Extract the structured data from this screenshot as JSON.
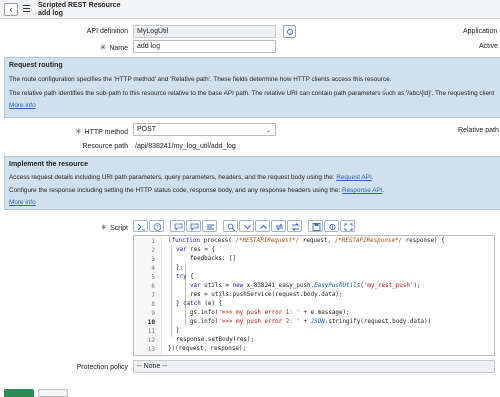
{
  "header": {
    "title": "Scripted REST Resource",
    "subtitle": "add log",
    "back_icon": "chevron-left-icon",
    "menu_icon": "hamburger-menu-icon"
  },
  "form": {
    "api_definition_label": "API definition",
    "api_definition_value": "MyLogUtil",
    "application_label": "Application",
    "name_label": "Name",
    "name_value": "add log",
    "active_label": "Active",
    "http_method_label": "HTTP method",
    "http_method_value": "POST",
    "relative_path_label": "Relative path",
    "resource_path_label": "Resource path",
    "resource_path_value": "/api/838241/my_log_util/add_log",
    "script_label": "Script",
    "protection_policy_label": "Protection policy",
    "protection_policy_value": "-- None --"
  },
  "request_routing": {
    "title": "Request routing",
    "line1": "The route configuration specifies the 'HTTP method' and 'Relative path'. These fields determine how HTTP clients access this resource.",
    "line2": "The relative path identifies the sub-path to this resource relative to the base API path. The relative URI can contain path parameters such as '/abc/{id}'. The requesting client",
    "more_info": "More info"
  },
  "implement_resource": {
    "title": "Implement the resource",
    "line1_prefix": "Access request details including URI path parameters, query parameters, headers, and the request body using the:",
    "line1_link": "Request API",
    "line1_suffix": ".",
    "line2_prefix": "Configure the response including setting the HTTP status code, response body, and any response headers using the:",
    "line2_link": "Response API",
    "line2_suffix": ".",
    "more_info": "More info"
  },
  "colors": {
    "info_box_bg": "#cfe0ee",
    "link": "#2d62b5",
    "header_bg": "#f3f4f5",
    "bottom_button": "#2e8b57"
  },
  "code_lines": {
    "n1": "1",
    "n2": "2",
    "n3": "3",
    "n4": "4",
    "n5": "5",
    "n6": "6",
    "n7": "7",
    "n8": "8",
    "n9": "9",
    "n10": "10",
    "n11": "11",
    "n12": "12",
    "n13": "13"
  }
}
